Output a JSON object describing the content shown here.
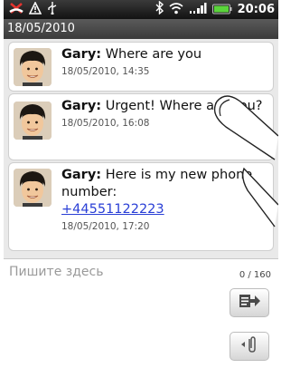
{
  "status_bar": {
    "time": "20:06",
    "icons": [
      "missed-call-icon",
      "warning-icon",
      "usb-icon",
      "bluetooth-icon",
      "wifi-icon",
      "signal-icon",
      "battery-icon"
    ]
  },
  "conversation": {
    "date_header": "18/05/2010",
    "messages": [
      {
        "sender": "Gary",
        "text": "Where are you",
        "time": "18/05/2010, 14:35"
      },
      {
        "sender": "Gary",
        "text": "Urgent! Where are you?",
        "time": "18/05/2010, 16:08"
      },
      {
        "sender": "Gary",
        "text": "Here is my new phone number:",
        "link": "+44551122223",
        "time": "18/05/2010, 17:20"
      }
    ]
  },
  "compose": {
    "placeholder": "Пишите здесь",
    "char_count": "0 / 160"
  },
  "colors": {
    "link": "#2a3fd6",
    "header_bg": "#3b3b3b"
  }
}
